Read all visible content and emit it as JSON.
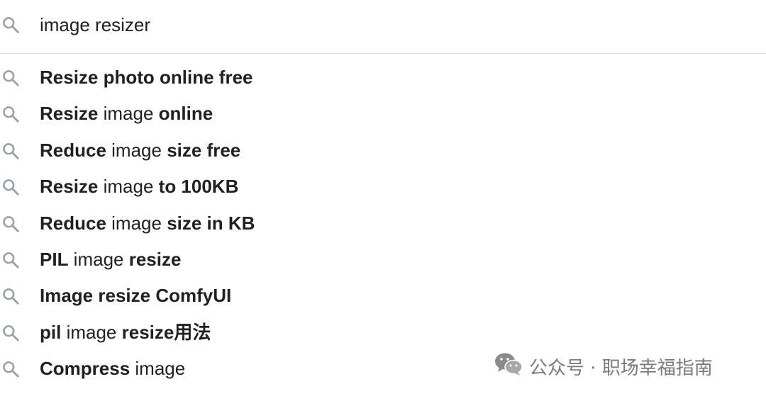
{
  "search": {
    "query": "image resizer",
    "icon": "search-icon"
  },
  "suggestions": [
    {
      "parts": [
        {
          "text": "Resize photo online free",
          "bold": true
        }
      ]
    },
    {
      "parts": [
        {
          "text": "Resize",
          "bold": true
        },
        {
          "text": " image ",
          "bold": false
        },
        {
          "text": "online",
          "bold": true
        }
      ]
    },
    {
      "parts": [
        {
          "text": "Reduce",
          "bold": true
        },
        {
          "text": " image ",
          "bold": false
        },
        {
          "text": "size free",
          "bold": true
        }
      ]
    },
    {
      "parts": [
        {
          "text": "Resize",
          "bold": true
        },
        {
          "text": " image ",
          "bold": false
        },
        {
          "text": "to 100KB",
          "bold": true
        }
      ]
    },
    {
      "parts": [
        {
          "text": "Reduce",
          "bold": true
        },
        {
          "text": " image ",
          "bold": false
        },
        {
          "text": "size in KB",
          "bold": true
        }
      ]
    },
    {
      "parts": [
        {
          "text": "PIL",
          "bold": true
        },
        {
          "text": " image ",
          "bold": false
        },
        {
          "text": "resize",
          "bold": true
        }
      ]
    },
    {
      "parts": [
        {
          "text": "Image resize ComfyUI",
          "bold": true
        }
      ]
    },
    {
      "parts": [
        {
          "text": "pil",
          "bold": true
        },
        {
          "text": " image ",
          "bold": false
        },
        {
          "text": "resize用法",
          "bold": true
        }
      ]
    },
    {
      "parts": [
        {
          "text": "Compress",
          "bold": true
        },
        {
          "text": " image",
          "bold": false
        }
      ]
    }
  ],
  "watermark": {
    "text": "公众号 · 职场幸福指南",
    "icon": "wechat-icon"
  },
  "colors": {
    "text": "#202124",
    "icon": "#9aa0a6",
    "divider": "#dadce0",
    "watermark": "#7a7a7a"
  }
}
